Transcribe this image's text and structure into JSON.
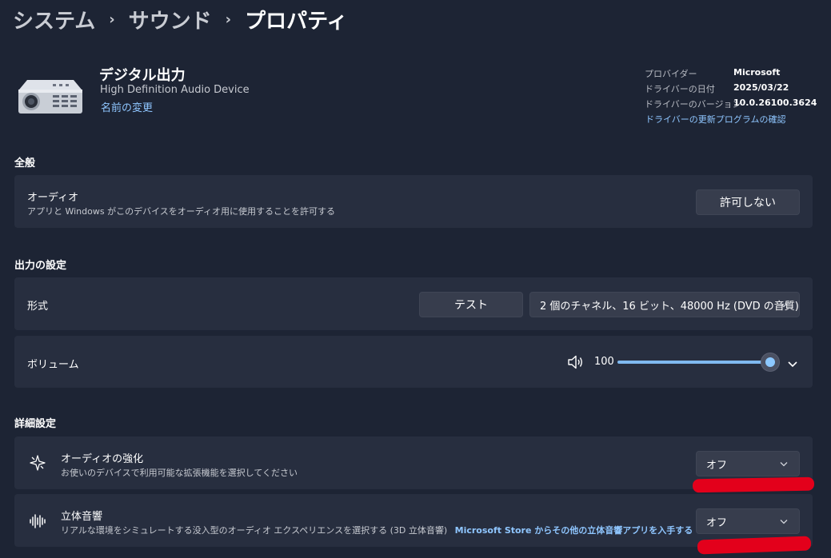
{
  "breadcrumb": {
    "level1": "システム",
    "level2": "サウンド",
    "current": "プロパティ"
  },
  "device": {
    "name": "デジタル出力",
    "subtitle": "High Definition Audio Device",
    "rename_link": "名前の変更",
    "icon": "projector-icon"
  },
  "driver": {
    "provider_label": "プロバイダー",
    "provider_value": "Microsoft",
    "date_label": "ドライバーの日付",
    "date_value": "2025/03/22",
    "version_label": "ドライバーのバージョン",
    "version_value": "10.0.26100.3624",
    "update_link": "ドライバーの更新プログラムの確認"
  },
  "general": {
    "heading": "全般",
    "audio_title": "オーディオ",
    "audio_desc": "アプリと Windows がこのデバイスをオーディオ用に使用することを許可する",
    "audio_button": "許可しない"
  },
  "output": {
    "heading": "出力の設定",
    "format_label": "形式",
    "test_button": "テスト",
    "format_value": "2 個のチャネル、16 ビット、48000 Hz (DVD の音質)",
    "volume_label": "ボリューム",
    "volume_value": "100",
    "volume_level": 100
  },
  "advanced": {
    "heading": "詳細設定",
    "enhance_title": "オーディオの強化",
    "enhance_desc": "お使いのデバイスで利用可能な拡張機能を選択してください",
    "enhance_value": "オフ",
    "spatial_title": "立体音響",
    "spatial_desc": "リアルな環境をシミュレートする没入型のオーディオ エクスペリエンスを選択する (3D 立体音響)",
    "spatial_store_link": "Microsoft Store からその他の立体音響アプリを入手する",
    "spatial_value": "オフ"
  },
  "colors": {
    "background": "#1d2434",
    "card": "#272e3f",
    "accent": "#8fc6ff",
    "annotation": "#e3001b"
  }
}
